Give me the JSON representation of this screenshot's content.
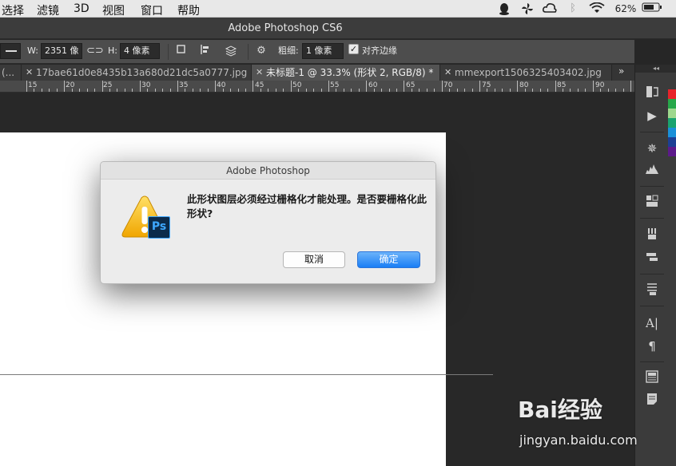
{
  "menubar": {
    "items": [
      "选择",
      "滤镜",
      "3D",
      "视图",
      "窗口",
      "帮助"
    ],
    "battery": "62%"
  },
  "app": {
    "title": "Adobe Photoshop CS6"
  },
  "options": {
    "w_label": "W:",
    "w_value": "2351 像",
    "h_label": "H:",
    "h_value": "4 像素",
    "weight_label": "粗细:",
    "weight_value": "1 像素",
    "align_label": "对齐边缘"
  },
  "tabs": [
    {
      "label": "(... "
    },
    {
      "label": "17bae61d0e8435b13a680d21dc5a0777.jpg"
    },
    {
      "label": "未标题-1 @ 33.3% (形状 2, RGB/8) *"
    },
    {
      "label": "mmexport1506325403402.jpg"
    }
  ],
  "ruler": {
    "labels": [
      "15",
      "20",
      "25",
      "30",
      "35",
      "40",
      "45",
      "50",
      "55",
      "60",
      "65",
      "70",
      "75",
      "80",
      "85",
      "90"
    ]
  },
  "dialog": {
    "title": "Adobe Photoshop",
    "message": "此形状图层必须经过栅格化才能处理。是否要栅格化此形状?",
    "ps_badge": "Ps",
    "cancel": "取消",
    "ok": "确定"
  },
  "watermark": {
    "brand": "Bai经验",
    "url": "jingyan.baidu.com"
  },
  "colors": {
    "accent": "#1a7ef5",
    "canvas": "#ffffff",
    "workspace": "#282828"
  }
}
